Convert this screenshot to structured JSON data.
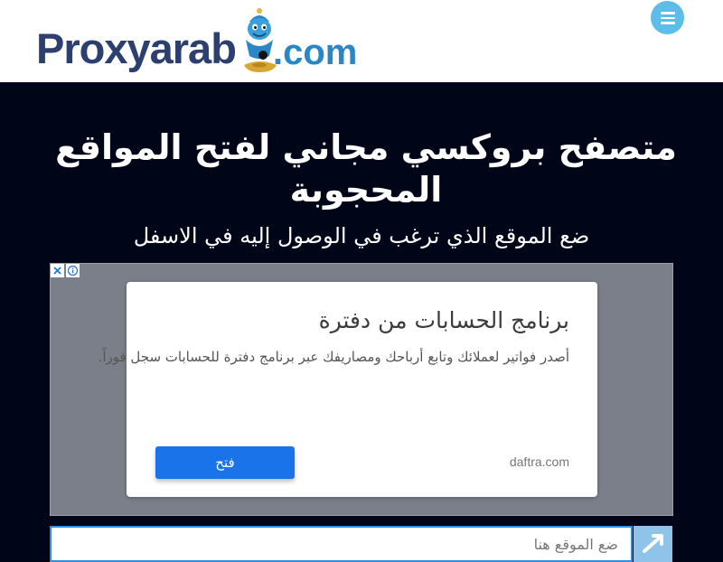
{
  "header": {
    "logo": {
      "text": "Proxyarab",
      "suffix": ".com",
      "mascot_icon": "genie-icon",
      "brand_color": "#2c3f6e",
      "accent_color": "#2b86c5"
    },
    "menu_icon": "hamburger-icon",
    "menu_button_color": "#5bbde8"
  },
  "hero": {
    "title": "متصفح بروكسي مجاني لفتح المواقع المحجوبة",
    "subtitle": "ضع الموقع الذي ترغب في الوصول إليه في الاسفل",
    "background_color": "#000518"
  },
  "ad": {
    "close_icon": "close-icon",
    "info_icon": "info-icon",
    "title": "برنامج الحسابات من دفترة",
    "description": "أصدر فواتير لعملائك وتابع أرباحك ومصاريفك عبر برنامج دفترة للحسابات سجل فوراً.",
    "domain": "daftra.com",
    "button_label": "فتح",
    "button_color": "#1a73e8"
  },
  "search": {
    "placeholder": "ضع الموقع هنا",
    "go_icon": "arrow-icon"
  }
}
